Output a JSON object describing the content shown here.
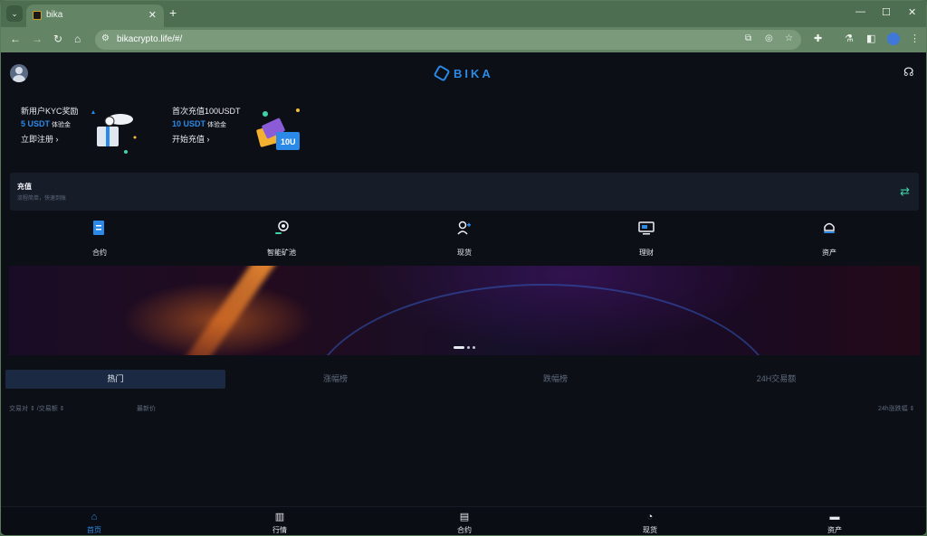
{
  "browser": {
    "tab_title": "bika",
    "tab_close": "✕",
    "new_tab": "+",
    "url": "bikacrypto.life/#/",
    "window_controls": [
      "—",
      "☐",
      "✕"
    ]
  },
  "header": {
    "logo_text": "BIKA"
  },
  "promos": [
    {
      "title": "新用户KYC奖励",
      "amount": "5 USDT",
      "amount_suffix": "体验金",
      "link": "立即注册 ›"
    },
    {
      "title": "首次充值100USDT",
      "amount": "10 USDT",
      "amount_suffix": "体验金",
      "link": "开始充值 ›",
      "badge": "10U"
    }
  ],
  "deposit": {
    "title": "充值",
    "subtitle": "流程简单，快速到账"
  },
  "quick_actions": [
    {
      "label": "合约",
      "icon": "contract-icon"
    },
    {
      "label": "智能矿池",
      "icon": "mining-pool-icon"
    },
    {
      "label": "现货",
      "icon": "spot-icon"
    },
    {
      "label": "理财",
      "icon": "finance-icon"
    },
    {
      "label": "资产",
      "icon": "assets-icon"
    }
  ],
  "market_tabs": [
    "热门",
    "涨幅榜",
    "跌幅榜",
    "24H交易额"
  ],
  "market_active_tab": "热门",
  "columns": {
    "pair": "交易对 ⇕ /交易额 ⇕",
    "price": "最新价",
    "change": "24h涨跌幅 ⇕"
  },
  "bottom_nav": [
    {
      "label": "首页",
      "icon": "home-icon",
      "active": true
    },
    {
      "label": "行情",
      "icon": "market-icon",
      "active": false
    },
    {
      "label": "合约",
      "icon": "contract-icon",
      "active": false
    },
    {
      "label": "现货",
      "icon": "spot-icon",
      "active": false
    },
    {
      "label": "资产",
      "icon": "wallet-icon",
      "active": false
    }
  ],
  "colors": {
    "accent": "#2b8ae8",
    "page_bg": "#0c0f16",
    "chrome": "#638465"
  }
}
